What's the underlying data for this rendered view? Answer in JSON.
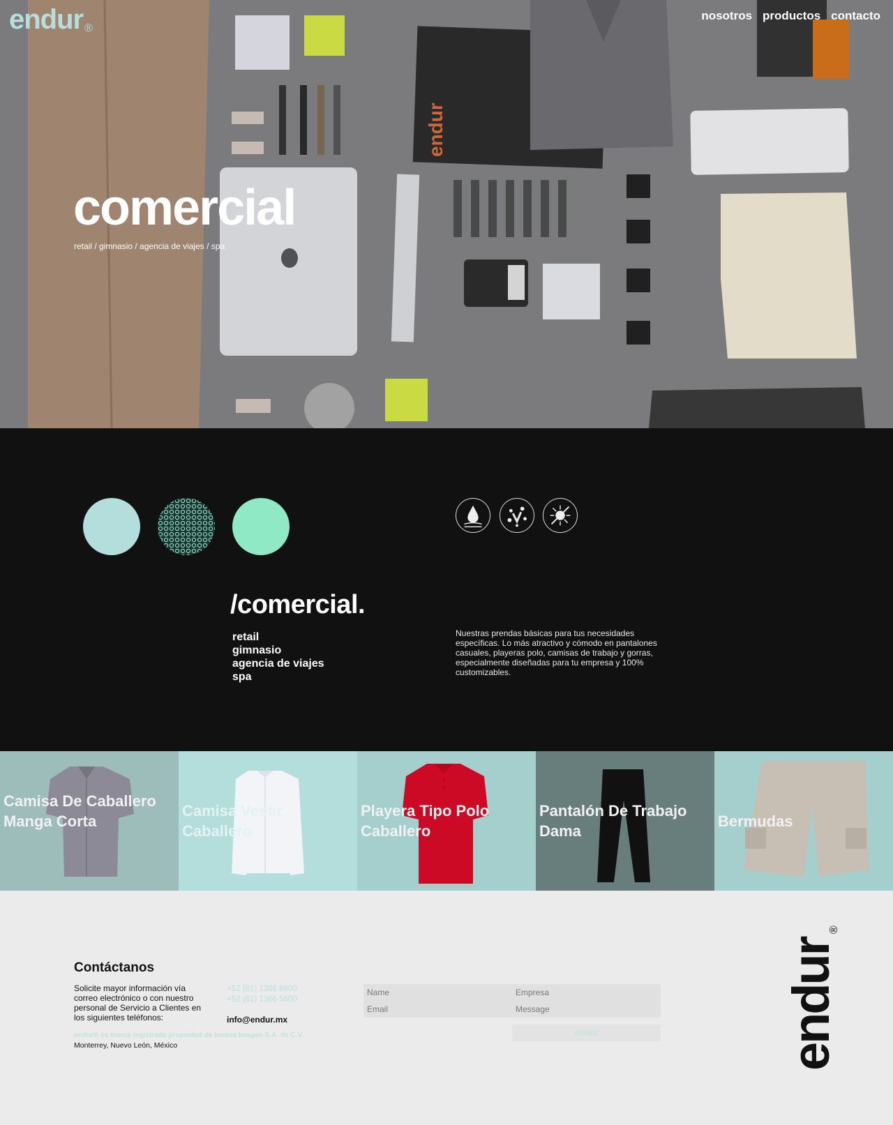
{
  "header": {
    "logo_text": "endur",
    "logo_mark": "®",
    "nav": [
      {
        "label": "nosotros"
      },
      {
        "label": "productos"
      },
      {
        "label": "contacto"
      }
    ]
  },
  "hero": {
    "title": "comercial",
    "subtitle": "retail / gimnasio / agencia de viajes / spa"
  },
  "category": {
    "title": "/comercial.",
    "items": [
      "retail",
      "gimnasio",
      "agencia de viajes",
      "spa"
    ],
    "description": "Nuestras prendas básicas para tus necesidades específicas. Lo más atractivo y cómodo en pantalones casuales, playeras polo, camisas de trabajo y gorras, especialmente diseñadas para tu empresa y 100% customizables.",
    "swatch_colors": [
      "#b3dedb",
      "#1d3432",
      "#8ee9c4"
    ],
    "feature_icons": [
      "water-repellent-icon",
      "stain-resistant-icon",
      "antibacterial-icon"
    ]
  },
  "products": [
    {
      "label": "Camisa De Caballero Manga Corta",
      "bg": "#9dbdba",
      "icon": "shirt-short-sleeve"
    },
    {
      "label": "Camisa Vestir Caballero",
      "bg": "#b3dedb",
      "icon": "dress-shirt"
    },
    {
      "label": "Playera Tipo Polo Caballero",
      "bg": "#a4cfcc",
      "icon": "polo-shirt"
    },
    {
      "label": "Pantalón De Trabajo Dama",
      "bg": "#677e7c",
      "icon": "trousers"
    },
    {
      "label": "Bermudas",
      "bg": "#a4cfcc",
      "icon": "shorts"
    }
  ],
  "footer": {
    "title": "Contáctanos",
    "text": "Solicite mayor información vía correo electrónico o con nuestro personal de Servicio a Clientes en los siguientes teléfonos:",
    "phones": [
      "+52 (81) 1366 6800",
      "+52 (81) 1366 5600"
    ],
    "email": "info@endur.mx",
    "legal": "endur® es marca registrada propiedad de Innova Imagen S.A. de C.V.",
    "city": "Monterrey, Nuevo León, México",
    "form": {
      "name_placeholder": "Name",
      "company_placeholder": "Empresa",
      "email_placeholder": "Email",
      "message_placeholder": "Message",
      "send_label": "enviar"
    },
    "vertical_logo_text": "endur",
    "vertical_logo_mark": "®"
  }
}
